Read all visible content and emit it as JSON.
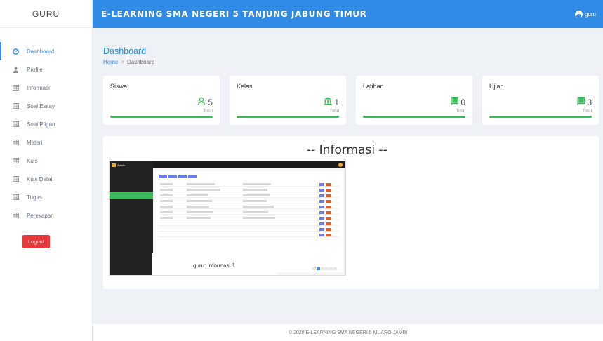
{
  "sidebar": {
    "brand": "GURU",
    "items": [
      {
        "label": "Dashboard",
        "icon": "dashboard-icon",
        "active": true
      },
      {
        "label": "Profile",
        "icon": "user-icon"
      },
      {
        "label": "Informasi",
        "icon": "table-icon"
      },
      {
        "label": "Soal Essay",
        "icon": "table-icon"
      },
      {
        "label": "Soal Pilgan",
        "icon": "table-icon"
      },
      {
        "label": "Materi",
        "icon": "table-icon"
      },
      {
        "label": "Kuis",
        "icon": "table-icon"
      },
      {
        "label": "Kuis Detail",
        "icon": "table-icon"
      },
      {
        "label": "Tugas",
        "icon": "table-icon"
      },
      {
        "label": "Perekapan",
        "icon": "table-icon"
      }
    ],
    "logout_label": "Logout"
  },
  "header": {
    "title": "E-LEARNING SMA NEGERI 5 TANJUNG JABUNG TIMUR",
    "user_label": "guru"
  },
  "page": {
    "title": "Dashboard",
    "breadcrumb": {
      "home": "Home",
      "separator": ">",
      "current": "Dashboard"
    }
  },
  "cards": [
    {
      "title": "Siswa",
      "value": "5",
      "sub": "Total",
      "icon": "user-outline-icon",
      "icon_color": "#3dbb5c"
    },
    {
      "title": "Kelas",
      "value": "1",
      "sub": "Total",
      "icon": "institution-icon",
      "icon_color": "#3dbb5c"
    },
    {
      "title": "Latihan",
      "value": "0",
      "sub": "Total",
      "icon": "book-icon",
      "icon_color": "#3dbb5c"
    },
    {
      "title": "Ujian",
      "value": "3",
      "sub": "Total",
      "icon": "book-icon",
      "icon_color": "#3dbb5c"
    }
  ],
  "info": {
    "heading": "-- Informasi --",
    "caption": "guru: Informasi 1",
    "thumb_brand": "Admin"
  },
  "footer": {
    "text": "© 2020 E-LEARNING SMA NEGERI 5 MUARO JAMBI"
  },
  "colors": {
    "primary": "#2f8be6",
    "success": "#3dbb5c",
    "danger": "#e8393c"
  }
}
